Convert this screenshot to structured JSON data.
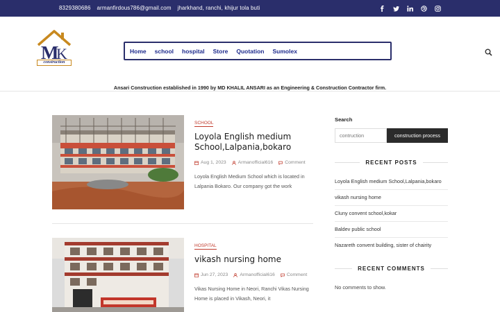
{
  "topbar": {
    "phone": "8329380686",
    "email": "armanfirdous786@gmail.com",
    "address": "jharkhand, ranchi, khijur tola buti",
    "social_icons": [
      "facebook-icon",
      "twitter-icon",
      "linkedin-icon",
      "dribbble-icon",
      "instagram-icon"
    ],
    "background": "#2a2e6b"
  },
  "header": {
    "logo_text": "construction",
    "nav": [
      "Home",
      "school",
      "hospital",
      "Store",
      "Quotation",
      "Sumolex"
    ],
    "nav_color": "#1d2a8c",
    "tagline": "Ansari Construction established in 1990 by MD KHALIL ANSARI as an Engineering & Construction Contractor firm."
  },
  "posts": [
    {
      "category": "SCHOOL",
      "title": "Loyola English medium School,Lalpania,bokaro",
      "date": "Aug 1, 2023",
      "author": "Armanofficial616",
      "comment_label": "Comment",
      "excerpt": "Loyola English Medium School which is located in Lalpania Bokaro.  Our company got the work"
    },
    {
      "category": "HOSPITAL",
      "title": "vikash nursing home",
      "date": "Jun 27, 2023",
      "author": "Armanofficial616",
      "comment_label": "Comment",
      "excerpt": "Vikas Nursing Home in Neori, Ranchi Vikas Nursing Home is placed in Vikash, Neori, it"
    }
  ],
  "sidebar": {
    "search_label": "Search",
    "search_value": "contruction",
    "search_button": "construction process",
    "recent_posts_title": "RECENT POSTS",
    "recent_posts": [
      "Loyola English medium School,Lalpania,bokaro",
      "vikash nursing home",
      "Cluny convent school,kokar",
      "Baldev public school",
      "Nazareth convent building, sister of chairity"
    ],
    "recent_comments_title": "RECENT COMMENTS",
    "no_comments": "No comments to show."
  },
  "accent_color": "#c0392b"
}
